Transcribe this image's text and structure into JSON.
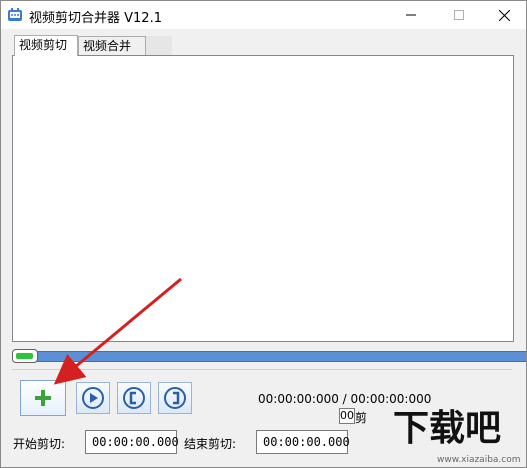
{
  "window": {
    "title": "视频剪切合并器 V12.1",
    "close_glyph": "✕",
    "min_glyph": "—",
    "max_glyph": "☐"
  },
  "tabs": [
    {
      "label": "视频剪切",
      "active": true
    },
    {
      "label": "视频合并",
      "active": false
    }
  ],
  "player": {
    "progress": 0
  },
  "controls": {
    "add_icon": "plus-icon",
    "play_icon": "play-icon",
    "mark_in_icon": "bracket-left-icon",
    "mark_out_icon": "bracket-right-icon",
    "time_readout": "00:00:00:000 / 00:00:00:000",
    "small_field_value": "00",
    "small_field_label": "剪"
  },
  "cut": {
    "start_label": "开始剪切:",
    "start_value": "00:00:00.000",
    "end_label": "结束剪切:",
    "end_value": "00:00:00.000"
  },
  "watermark": {
    "text": "下载吧",
    "url": "www.xiazaiba.com"
  },
  "colors": {
    "progress": "#5b8fd6",
    "handle_fill": "#2ec43c",
    "add_plus": "#3aa33a",
    "arrow": "#d42020",
    "button_icon": "#2a5fa8"
  }
}
